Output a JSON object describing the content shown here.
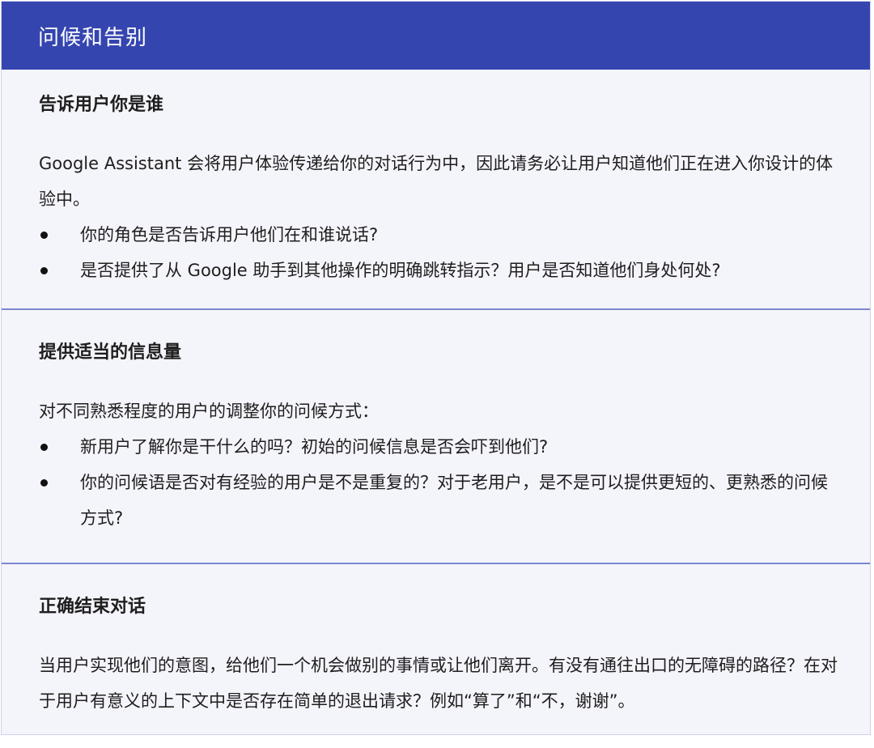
{
  "header": {
    "title": "问候和告别"
  },
  "sections": [
    {
      "title": "告诉用户你是谁",
      "intro": "Google Assistant 会将用户体验传递给你的对话行为中，因此请务必让用户知道他们正在进入你设计的体验中。",
      "bullets": [
        "你的角色是否告诉用户他们在和谁说话?",
        "是否提供了从 Google 助手到其他操作的明确跳转指示？用户是否知道他们身处何处?"
      ]
    },
    {
      "title": "提供适当的信息量",
      "intro": "对不同熟悉程度的用户的调整你的问候方式：",
      "bullets": [
        "新用户了解你是干什么的吗？初始的问候信息是否会吓到他们?",
        "你的问候语是否对有经验的用户是不是重复的？对于老用户，是不是可以提供更短的、更熟悉的问候方式?"
      ]
    },
    {
      "title": "正确结束对话",
      "intro": "当用户实现他们的意图，给他们一个机会做别的事情或让他们离开。有没有通往出口的无障碍的路径？在对于用户有意义的上下文中是否存在简单的退出请求？例如“算了”和“不，谢谢”。",
      "bullets": []
    }
  ],
  "colors": {
    "header_bg": "#3545b0",
    "card_bg": "#f4f4fb",
    "divider": "#7d87cf"
  }
}
